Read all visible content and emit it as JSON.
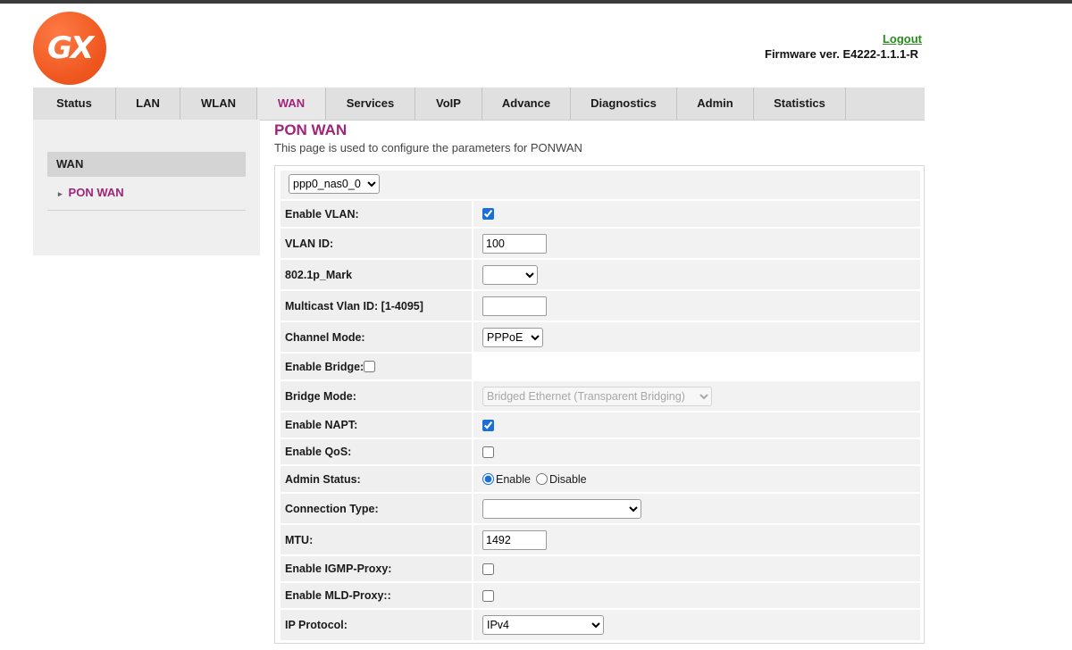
{
  "brand": {
    "logo_text": "GX",
    "accent_color": "#f05a22"
  },
  "header": {
    "logout_label": "Logout",
    "firmware_label": "Firmware ver. E4222-1.1.1-R"
  },
  "nav": {
    "items": [
      "Status",
      "LAN",
      "WLAN",
      "WAN",
      "Services",
      "VoIP",
      "Advance",
      "Diagnostics",
      "Admin",
      "Statistics"
    ],
    "active": "WAN",
    "active_color": "#a0247a"
  },
  "sidebar": {
    "header": "WAN",
    "items": [
      {
        "label": "PON WAN",
        "active": true
      }
    ]
  },
  "page": {
    "title": "PON WAN",
    "description": "This page is used to configure the parameters for PONWAN"
  },
  "form": {
    "connection_select": "ppp0_nas0_0",
    "enable_vlan": {
      "label": "Enable VLAN:",
      "checked": true
    },
    "vlan_id": {
      "label": "VLAN ID:",
      "value": "100"
    },
    "mark_8021p": {
      "label": "802.1p_Mark",
      "value": ""
    },
    "multicast_vlan": {
      "label": "Multicast Vlan ID: [1-4095]",
      "value": ""
    },
    "channel_mode": {
      "label": "Channel Mode:",
      "value": "PPPoE"
    },
    "enable_bridge": {
      "label": "Enable Bridge:",
      "checked": false
    },
    "bridge_mode": {
      "label": "Bridge Mode:",
      "value": "Bridged Ethernet (Transparent Bridging)",
      "disabled": true
    },
    "enable_napt": {
      "label": "Enable NAPT:",
      "checked": true
    },
    "enable_qos": {
      "label": "Enable QoS:",
      "checked": false
    },
    "admin_status": {
      "label": "Admin Status:",
      "options": [
        "Enable",
        "Disable"
      ],
      "selected": "Enable"
    },
    "connection_type": {
      "label": "Connection Type:",
      "value": ""
    },
    "mtu": {
      "label": "MTU:",
      "value": "1492"
    },
    "igmp_proxy": {
      "label": "Enable IGMP-Proxy:",
      "checked": false
    },
    "mld_proxy": {
      "label": "Enable MLD-Proxy::",
      "checked": false
    },
    "ip_protocol": {
      "label": "IP Protocol:",
      "value": "IPv4"
    }
  }
}
